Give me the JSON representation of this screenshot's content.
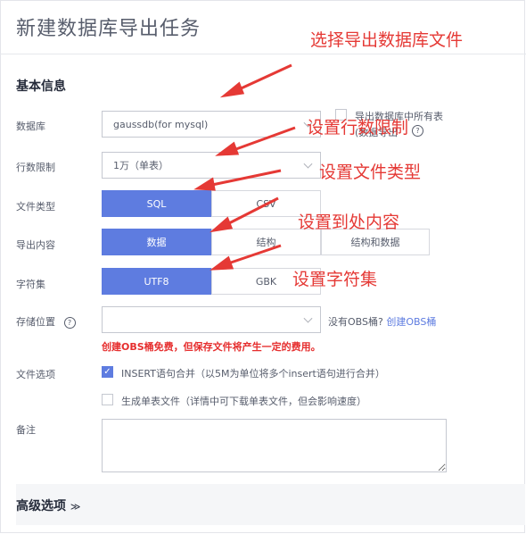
{
  "page": {
    "title": "新建数据库导出任务",
    "section_basic": "基本信息",
    "section_advanced": "高级选项"
  },
  "labels": {
    "database": "数据库",
    "row_limit": "行数限制",
    "file_type": "文件类型",
    "export_content": "导出内容",
    "charset": "字符集",
    "storage": "存储位置",
    "file_options": "文件选项",
    "remark": "备注"
  },
  "database": {
    "value": "gaussdb(for mysql)",
    "side_text_line1": "导出数据库中所有表",
    "side_text_line2": "(数据导出"
  },
  "row_limit": {
    "value": "1万（单表）"
  },
  "file_type": {
    "options": [
      "SQL",
      "CSV"
    ],
    "selected": "SQL"
  },
  "export_content": {
    "options": [
      "数据",
      "结构",
      "结构和数据"
    ],
    "selected": "数据"
  },
  "charset": {
    "options": [
      "UTF8",
      "GBK"
    ],
    "selected": "UTF8"
  },
  "storage": {
    "value": "",
    "no_obs_text": "没有OBS桶?",
    "create_link": "创建OBS桶",
    "warning": "创建OBS桶免费，但保存文件将产生一定的费用。"
  },
  "file_options": [
    {
      "label": "INSERT语句合并（以5M为单位将多个insert语句进行合并）",
      "checked": true
    },
    {
      "label": "生成单表文件（详情中可下载单表文件，但会影响速度）",
      "checked": false
    }
  ],
  "remark": {
    "value": ""
  },
  "annotations": {
    "a1": "选择导出数据库文件",
    "a2": "设置行数限制",
    "a3": "设置文件类型",
    "a4": "设置到处内容",
    "a5": "设置字符集"
  },
  "colors": {
    "accent": "#5e7ce0",
    "annotation": "#e53935",
    "warning": "#e62e2e"
  }
}
